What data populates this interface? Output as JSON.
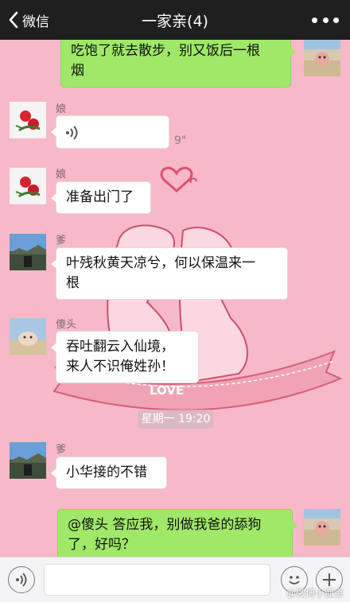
{
  "header": {
    "back_label": "微信",
    "title": "一家亲(4)"
  },
  "messages": [
    {
      "side": "right",
      "text_lines": [
        "吃饱了就去散步，别又饭后一根",
        "烟"
      ]
    },
    {
      "side": "left",
      "sender": "娘",
      "type": "voice",
      "duration": "9\""
    },
    {
      "side": "left",
      "sender": "娘",
      "text_lines": [
        "准备出门了"
      ]
    },
    {
      "side": "left",
      "sender": "爹",
      "text_lines": [
        "叶残秋黄天凉兮，何以保温来一",
        "根"
      ]
    },
    {
      "side": "left",
      "sender": "傻头",
      "text_lines": [
        "吞吐翻云入仙境，",
        "来人不识俺姓孙！"
      ]
    },
    {
      "side": "left",
      "sender": "爹",
      "text_lines": [
        "小华接的不错"
      ]
    },
    {
      "side": "right",
      "text_lines": [
        "@傻头 答应我，别做我爸的舔狗",
        "了，好吗？"
      ]
    }
  ],
  "timestamp": "星期一 19:20",
  "background": {
    "love_label": "LOVE"
  },
  "watermark": "@微博小亚崽",
  "colors": {
    "chat_bg": "#f7b8c8",
    "self_bubble": "#9fe868",
    "topbar": "#1f1f1f"
  },
  "icons": [
    "chevron-left-icon",
    "more-dots-icon",
    "voice-icon",
    "emoji-icon",
    "plus-icon"
  ]
}
